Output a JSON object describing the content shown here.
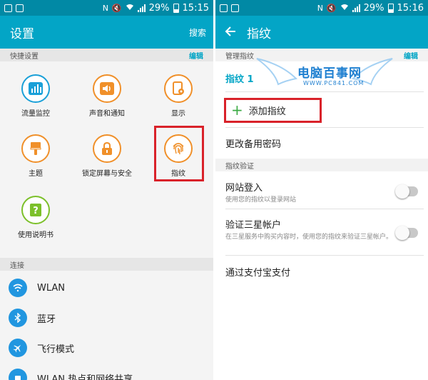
{
  "left_screen": {
    "status": {
      "battery": "29%",
      "time": "15:15"
    },
    "title": "设置",
    "search_label": "搜索",
    "quick_section": {
      "label": "快捷设置",
      "edit": "编辑"
    },
    "quick_items": [
      {
        "label": "流量监控",
        "icon": "bar-chart-icon"
      },
      {
        "label": "声音和通知",
        "icon": "speaker-icon"
      },
      {
        "label": "显示",
        "icon": "display-settings-icon"
      },
      {
        "label": "主题",
        "icon": "paint-brush-icon"
      },
      {
        "label": "锁定屏幕与安全",
        "icon": "lock-icon"
      },
      {
        "label": "指纹",
        "icon": "fingerprint-icon"
      },
      {
        "label": "使用说明书",
        "icon": "help-book-icon"
      }
    ],
    "connect_section": {
      "label": "连接"
    },
    "connect_items": [
      {
        "label": "WLAN",
        "icon": "wifi-icon"
      },
      {
        "label": "蓝牙",
        "icon": "bluetooth-icon"
      },
      {
        "label": "飞行模式",
        "icon": "airplane-icon"
      },
      {
        "label": "WLAN 热点和网络共享",
        "icon": "hotspot-icon"
      }
    ]
  },
  "right_screen": {
    "status": {
      "battery": "29%",
      "time": "15:16"
    },
    "title": "指纹",
    "manage_section": {
      "label": "管理指纹",
      "edit": "编辑"
    },
    "fingerprint_1": "指纹 1",
    "add_fingerprint": "添加指纹",
    "change_backup_password": "更改备用密码",
    "verify_section": {
      "label": "指纹验证"
    },
    "web_login": {
      "title": "网站登入",
      "subtitle": "使用您的指纹以登录网站"
    },
    "samsung_account": {
      "title": "验证三星帐户",
      "subtitle": "在三星服务中购买内容时，使用您的指纹来验证三星帐户。"
    },
    "alipay": "通过支付宝支付"
  },
  "watermark": {
    "title": "电脑百事网",
    "url": "WWW.PC841.COM"
  },
  "colors": {
    "status_bar": "#0189a5",
    "app_bar": "#03a5c6",
    "highlight_box": "#d9222a",
    "blue_icon": "#1aa0d8",
    "orange_icon": "#f0902a",
    "green_icon": "#7cc02a",
    "add_plus": "#3cab45"
  }
}
